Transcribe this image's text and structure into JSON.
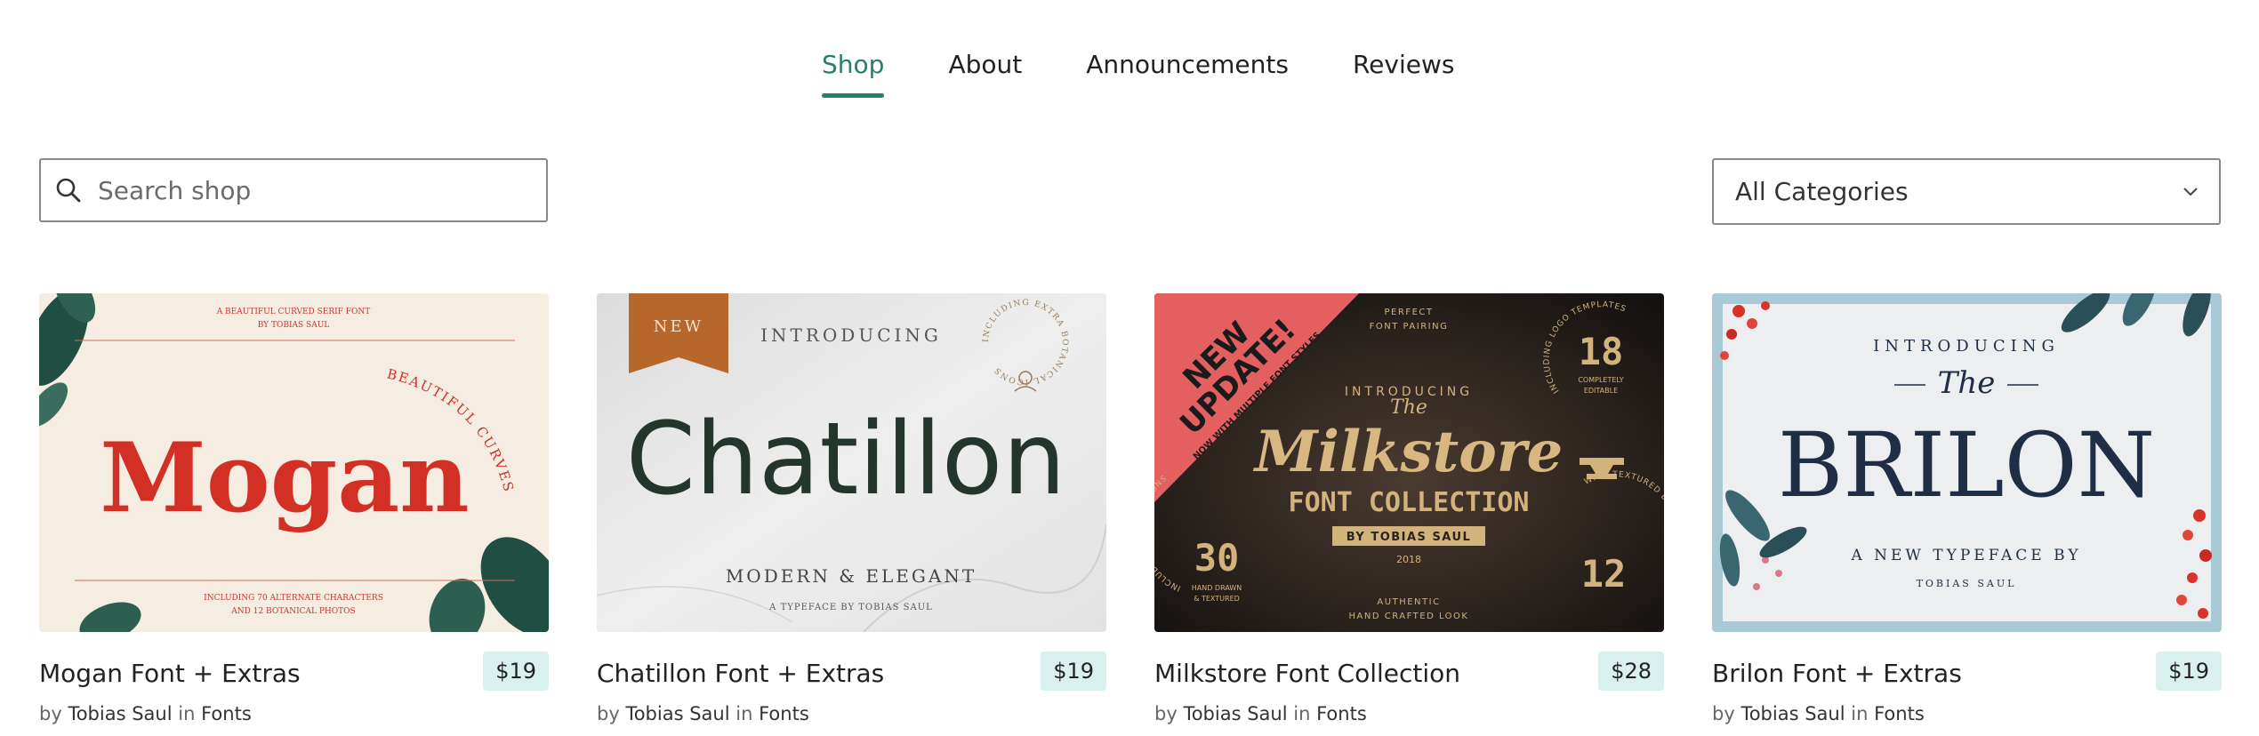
{
  "nav": {
    "tabs": [
      {
        "label": "Shop",
        "active": true
      },
      {
        "label": "About"
      },
      {
        "label": "Announcements"
      },
      {
        "label": "Reviews"
      }
    ]
  },
  "search": {
    "placeholder": "Search shop",
    "icon": "search-icon"
  },
  "category_select": {
    "value": "All Categories",
    "icon": "chevron-down-icon"
  },
  "colors": {
    "accent": "#2a7d6c",
    "price_bg": "#d8f1ee"
  },
  "byline": {
    "by": "by",
    "in": "in"
  },
  "products": [
    {
      "title": "Mogan Font + Extras",
      "price": "$19",
      "author": "Tobias Saul",
      "category": "Fonts",
      "art": {
        "top1": "A BEAUTIFUL CURVED SERIF FONT",
        "top2": "BY TOBIAS SAUL",
        "name": "Mogan",
        "arc": "BEAUTIFUL CURVES",
        "bottom1": "INCLUDING 70 ALTERNATE CHARACTERS",
        "bottom2": "AND 12 BOTANICAL PHOTOS"
      }
    },
    {
      "title": "Chatillon Font + Extras",
      "price": "$19",
      "author": "Tobias Saul",
      "category": "Fonts",
      "art": {
        "ribbon": "NEW",
        "intro": "INTRODUCING",
        "name": "Chatillon",
        "tag": "MODERN & ELEGANT",
        "by": "A TYPEFACE BY TOBIAS SAUL",
        "seal": "INCLUDING EXTRA BOTANICAL ICONS"
      }
    },
    {
      "title": "Milkstore Font Collection",
      "price": "$28",
      "author": "Tobias Saul",
      "category": "Fonts",
      "art": {
        "banner1": "NEW",
        "banner2": "UPDATE!",
        "banner3": "NOW WITH MULTIPLE FONT STYLES",
        "perfect1": "PERFECT",
        "perfect2": "FONT PAIRING",
        "intro": "INTRODUCING",
        "the": "The",
        "name": "Milkstore",
        "collection": "FONT COLLECTION",
        "by": "BY TOBIAS SAUL",
        "year": "2018",
        "num1": "18",
        "lbl1a": "COMPLETELY",
        "lbl1b": "EDITABLE",
        "arc1": "INCLUDING LOGO TEMPLATES",
        "num2": "30",
        "lbl2a": "HAND DRAWN",
        "lbl2b": "& TEXTURED",
        "arc2": "INCLUDING VARIOUS ICONS",
        "num3": "12",
        "arc3": "WITH TEXTURED BACKGROUNDS",
        "auth1": "AUTHENTIC",
        "auth2": "HAND CRAFTED LOOK"
      }
    },
    {
      "title": "Brilon Font + Extras",
      "price": "$19",
      "author": "Tobias Saul",
      "category": "Fonts",
      "art": {
        "intro": "INTRODUCING",
        "the": "The",
        "name": "BRILON",
        "sub": "A NEW TYPEFACE BY",
        "by": "TOBIAS SAUL"
      }
    }
  ]
}
